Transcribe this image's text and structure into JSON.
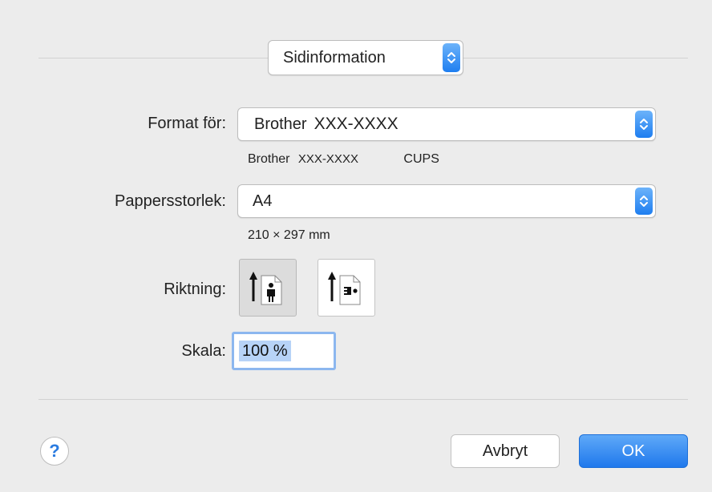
{
  "section_popup": {
    "value": "Sidinformation"
  },
  "format_for": {
    "label": "Format för:",
    "value_prefix": "Brother",
    "value_model": "XXX-XXXX",
    "detail_prefix": "Brother",
    "detail_model": "XXX-XXXX",
    "detail_suffix": "CUPS"
  },
  "paper_size": {
    "label": "Pappersstorlek:",
    "value": "A4",
    "dimensions": "210 × 297 mm"
  },
  "orientation": {
    "label": "Riktning:",
    "options": [
      "portrait",
      "landscape"
    ],
    "selected": "portrait"
  },
  "scale": {
    "label": "Skala:",
    "value": "100 %"
  },
  "buttons": {
    "help": "?",
    "cancel": "Avbryt",
    "ok": "OK"
  },
  "colors": {
    "accent": "#1f78ec",
    "selection": "#b7d3f7",
    "background": "#ececec"
  },
  "icons": {
    "stepper": "up-down-chevron-icon",
    "portrait": "portrait-orientation-icon",
    "landscape": "landscape-orientation-icon",
    "help": "question-mark-icon"
  }
}
